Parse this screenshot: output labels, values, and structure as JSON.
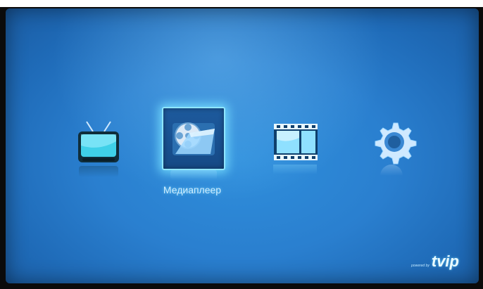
{
  "menu": {
    "items": [
      {
        "name": "tv",
        "icon": "tv-icon"
      },
      {
        "name": "mediaplayer",
        "icon": "media-folder-icon",
        "label": "Медиаплеер",
        "selected": true
      },
      {
        "name": "video",
        "icon": "film-strip-icon"
      },
      {
        "name": "settings",
        "icon": "gear-icon"
      }
    ],
    "selected_label": "Медиаплеер"
  },
  "brand": {
    "small": "powered by",
    "logo": "tvip"
  },
  "colors": {
    "background": "#2a7fcf",
    "highlight": "#8fe6ff"
  }
}
